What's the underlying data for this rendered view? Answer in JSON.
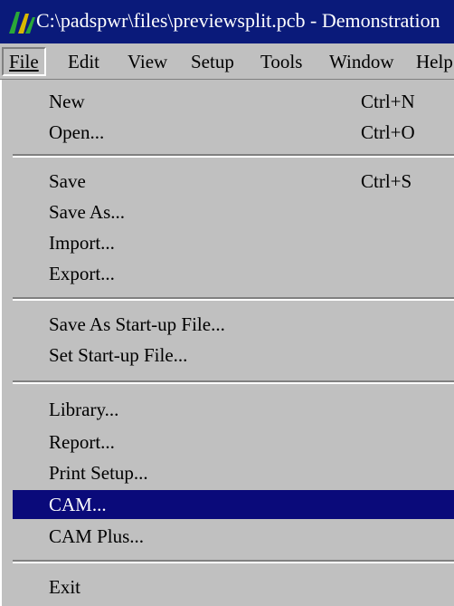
{
  "window": {
    "title": "C:\\padspwr\\files\\previewsplit.pcb - Demonstration"
  },
  "menubar": {
    "items": [
      {
        "label": "File"
      },
      {
        "label": "Edit"
      },
      {
        "label": "View"
      },
      {
        "label": "Setup"
      },
      {
        "label": "Tools"
      },
      {
        "label": "Window"
      },
      {
        "label": "Help"
      }
    ]
  },
  "file_menu": {
    "items": [
      {
        "label": "New",
        "shortcut": "Ctrl+N"
      },
      {
        "label": "Open...",
        "shortcut": "Ctrl+O"
      },
      {
        "label": "Save",
        "shortcut": "Ctrl+S"
      },
      {
        "label": "Save As...",
        "shortcut": ""
      },
      {
        "label": "Import...",
        "shortcut": ""
      },
      {
        "label": "Export...",
        "shortcut": ""
      },
      {
        "label": "Save As Start-up File...",
        "shortcut": ""
      },
      {
        "label": "Set Start-up File...",
        "shortcut": ""
      },
      {
        "label": "Library...",
        "shortcut": ""
      },
      {
        "label": "Report...",
        "shortcut": ""
      },
      {
        "label": "Print Setup...",
        "shortcut": ""
      },
      {
        "label": "CAM...",
        "shortcut": ""
      },
      {
        "label": "CAM Plus...",
        "shortcut": ""
      },
      {
        "label": "Exit",
        "shortcut": ""
      }
    ],
    "highlighted": "CAM..."
  },
  "colors": {
    "titlebar": "#0a1a7a",
    "menu_bg": "#c0c0c0",
    "highlight": "#0a0a7a"
  }
}
